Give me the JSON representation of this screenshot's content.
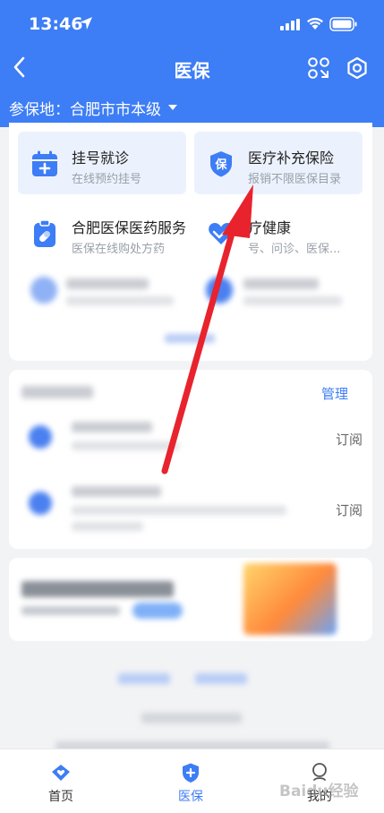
{
  "status_bar": {
    "time": "13:46"
  },
  "nav": {
    "title": "医保"
  },
  "region": {
    "label": "参保地：",
    "value": "合肥市市本级"
  },
  "services": [
    {
      "name": "挂号就诊",
      "desc": "在线预约挂号",
      "icon": "calendar-plus-icon",
      "highlighted": true
    },
    {
      "name": "医疗补充保险",
      "desc": "报销不限医保目录",
      "icon": "shield-bao-icon",
      "highlighted": true,
      "icon_text": "保"
    },
    {
      "name": "合肥医保医药服务",
      "desc": "医保在线购处方药",
      "icon": "medicine-clipboard-icon",
      "highlighted": false
    },
    {
      "name": "疗健康",
      "desc": "号、问诊、医保...",
      "icon": "heart-icon",
      "highlighted": false
    }
  ],
  "subscriptions": {
    "manage_label": "管理",
    "items": [
      {
        "action": "订阅"
      },
      {
        "action": "订阅"
      }
    ]
  },
  "tabbar": {
    "tabs": [
      {
        "label": "首页",
        "icon": "diamond-heart-icon",
        "active": false
      },
      {
        "label": "医保",
        "icon": "shield-plus-icon",
        "active": true
      },
      {
        "label": "我的",
        "icon": "person-icon",
        "active": false
      }
    ]
  },
  "watermark": {
    "text": "Baidu经验"
  },
  "colors": {
    "primary": "#3d7df5",
    "annotation_arrow": "#e8232d",
    "page_bg": "#f2f3f5"
  }
}
